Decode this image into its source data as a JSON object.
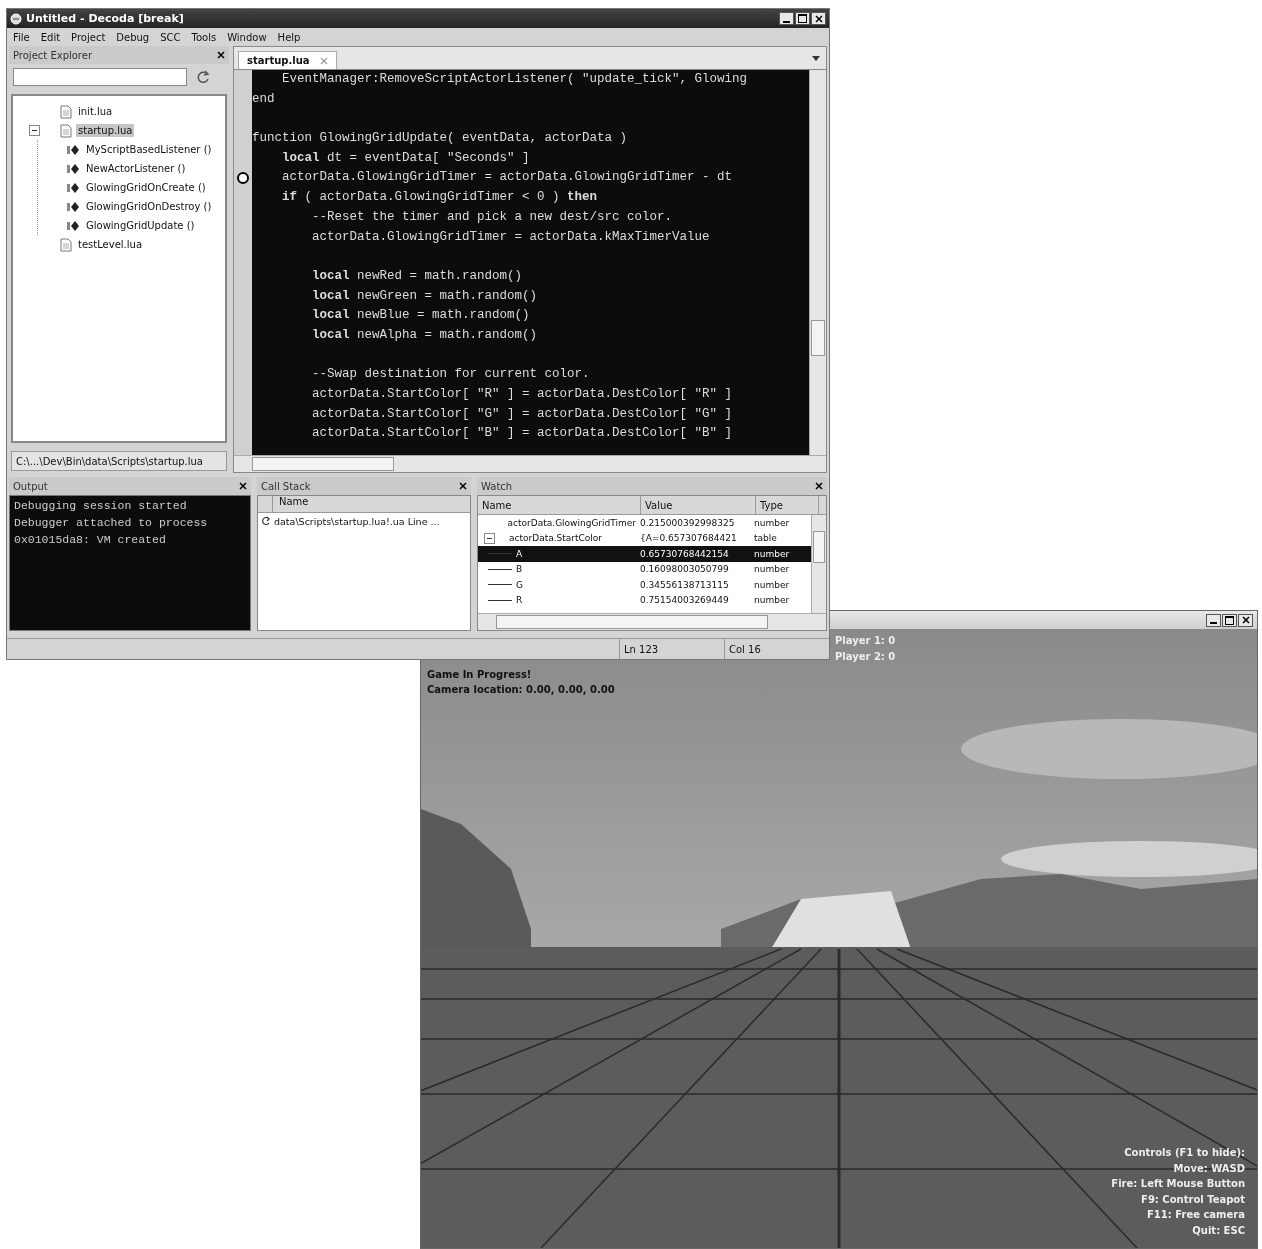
{
  "decoda_window": {
    "title": "Untitled - Decoda [break]",
    "menu": [
      "File",
      "Edit",
      "Project",
      "Debug",
      "SCC",
      "Tools",
      "Window",
      "Help"
    ],
    "project_explorer": {
      "title": "Project Explorer",
      "tree": [
        {
          "label": "init.lua",
          "kind": "file",
          "selected": false
        },
        {
          "label": "startup.lua",
          "kind": "file",
          "selected": true,
          "expanded": true,
          "children": [
            {
              "label": "MyScriptBasedListener ()",
              "kind": "function",
              "selected": false
            },
            {
              "label": "NewActorListener ()",
              "kind": "function",
              "selected": false
            },
            {
              "label": "GlowingGridOnCreate ()",
              "kind": "function",
              "selected": false
            },
            {
              "label": "GlowingGridOnDestroy ()",
              "kind": "function",
              "selected": false
            },
            {
              "label": "GlowingGridUpdate ()",
              "kind": "function",
              "selected": false
            }
          ]
        },
        {
          "label": "testLevel.lua",
          "kind": "file",
          "selected": false
        }
      ],
      "path": "C:\\...\\Dev\\Bin\\data\\Scripts\\startup.lua"
    },
    "editor": {
      "tabs": [
        {
          "label": "startup.lua",
          "selected": true
        }
      ],
      "lines": [
        {
          "kind": "code",
          "text": "    EventManager:RemoveScriptActorListener( \"update_tick\", Glowing",
          "current": false
        },
        {
          "kind": "code",
          "text": "end",
          "current": false
        },
        {
          "kind": "blank"
        },
        {
          "kind": "code",
          "text": "function GlowingGridUpdate( eventData, actorData )",
          "current": false
        },
        {
          "kind": "code",
          "text": "    **local** dt = eventData[ \"Seconds\" ]",
          "current": false
        },
        {
          "kind": "code",
          "text": "    actorData.GlowingGridTimer = actorData.GlowingGridTimer - dt",
          "current": true
        },
        {
          "kind": "code",
          "text": "    **if** ( actorData.GlowingGridTimer < 0 ) **then**",
          "current": false
        },
        {
          "kind": "code",
          "text": "        --Reset the timer and pick a new dest/src color.",
          "current": false
        },
        {
          "kind": "code",
          "text": "        actorData.GlowingGridTimer = actorData.kMaxTimerValue",
          "current": false
        },
        {
          "kind": "blank"
        },
        {
          "kind": "code",
          "text": "        **local** newRed = math.random()",
          "current": false
        },
        {
          "kind": "code",
          "text": "        **local** newGreen = math.random()",
          "current": false
        },
        {
          "kind": "code",
          "text": "        **local** newBlue = math.random()",
          "current": false
        },
        {
          "kind": "code",
          "text": "        **local** newAlpha = math.random()",
          "current": false
        },
        {
          "kind": "blank"
        },
        {
          "kind": "code",
          "text": "        --Swap destination for current color.",
          "current": false
        },
        {
          "kind": "code",
          "text": "        actorData.StartColor[ \"R\" ] = actorData.DestColor[ \"R\" ]",
          "current": false
        },
        {
          "kind": "code",
          "text": "        actorData.StartColor[ \"G\" ] = actorData.DestColor[ \"G\" ]",
          "current": false
        },
        {
          "kind": "code",
          "text": "        actorData.StartColor[ \"B\" ] = actorData.DestColor[ \"B\" ]",
          "current": false
        }
      ]
    },
    "output": {
      "title": "Output",
      "lines": [
        "Debugging session started",
        "Debugger attached to process",
        "0x01015da8: VM created"
      ]
    },
    "call_stack": {
      "title": "Call Stack",
      "columns": [
        "Name"
      ],
      "rows": [
        "data\\Scripts\\startup.lua!.ua Line ..."
      ]
    },
    "watch": {
      "title": "Watch",
      "columns": [
        "Name",
        "Value",
        "Type"
      ],
      "rows": [
        {
          "name": "actorData.GlowingGridTimer",
          "value": "0.215000392998325",
          "type": "number",
          "selected": false
        },
        {
          "name": "actorData.StartColor",
          "value": "{A=0.657307684421",
          "type": "table",
          "selected": false,
          "expanded": true,
          "children": [
            {
              "name": "A",
              "value": "0.65730768442154",
              "type": "number",
              "selected": true
            },
            {
              "name": "B",
              "value": "0.16098003050799",
              "type": "number",
              "selected": false
            },
            {
              "name": "G",
              "value": "0.34556138713115",
              "type": "number",
              "selected": false
            },
            {
              "name": "R",
              "value": "0.75154003269449",
              "type": "number",
              "selected": false
            }
          ]
        }
      ]
    },
    "status_bar": {
      "line": "Ln 123",
      "column": "Col 16"
    }
  },
  "game_window": {
    "scores": [
      "Player 1: 0",
      "Player 2: 0"
    ],
    "status_lines": [
      "Game In Progress!",
      "Camera location: 0.00, 0.00, 0.00"
    ],
    "controls": [
      "Controls (F1 to hide):",
      "Move: WASD",
      "Fire: Left Mouse Button",
      "F9: Control Teapot",
      "F11: Free camera",
      "Quit: ESC"
    ]
  }
}
